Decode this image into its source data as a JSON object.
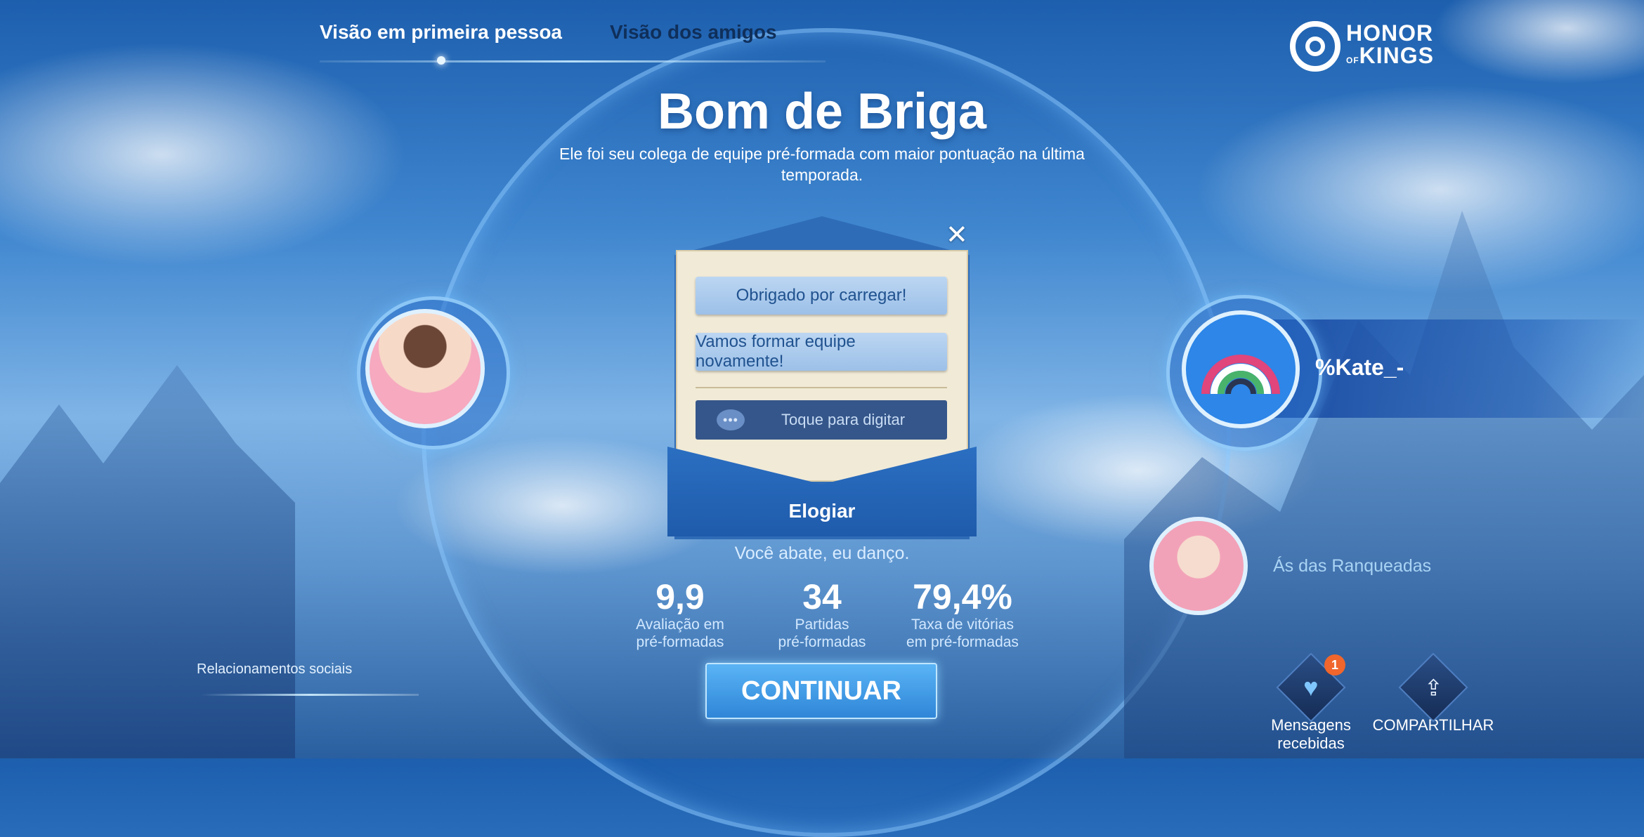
{
  "tabs": [
    {
      "label": "Visão em primeira pessoa",
      "active": true
    },
    {
      "label": "Visão dos amigos",
      "active": false
    }
  ],
  "logo": {
    "line1": "HONOR",
    "of": "OF",
    "line2": "KINGS"
  },
  "title": "Bom de Briga",
  "subtitle": "Ele foi seu colega de equipe pré-formada com maior pontuação na última temporada.",
  "card": {
    "options": [
      "Obrigado por carregar!",
      "Vamos formar equipe novamente!"
    ],
    "input_placeholder": "Toque para digitar",
    "action_label": "Elogiar",
    "close_icon": "close-icon"
  },
  "teammate": {
    "name": "%Kate_-",
    "rank_label": "Ás das Ranqueadas"
  },
  "quote": "Você abate, eu danço.",
  "stats": [
    {
      "value": "9,9",
      "label_line1": "Avaliação em",
      "label_line2": "pré-formadas"
    },
    {
      "value": "34",
      "label_line1": "Partidas",
      "label_line2": "pré-formadas"
    },
    {
      "value": "79,4%",
      "label_line1": "Taxa de vitórias",
      "label_line2": "em pré-formadas"
    }
  ],
  "continue_label": "CONTINUAR",
  "social_label": "Relacionamentos sociais",
  "actions": {
    "messages": {
      "line1": "Mensagens",
      "line2": "recebidas",
      "badge": "1",
      "icon": "heart-icon"
    },
    "share": {
      "label": "COMPARTILHAR",
      "icon": "share-icon"
    }
  },
  "colors": {
    "accent": "#2f86d8",
    "badge": "#f0662c",
    "rank_text": "#a9d3f4"
  }
}
